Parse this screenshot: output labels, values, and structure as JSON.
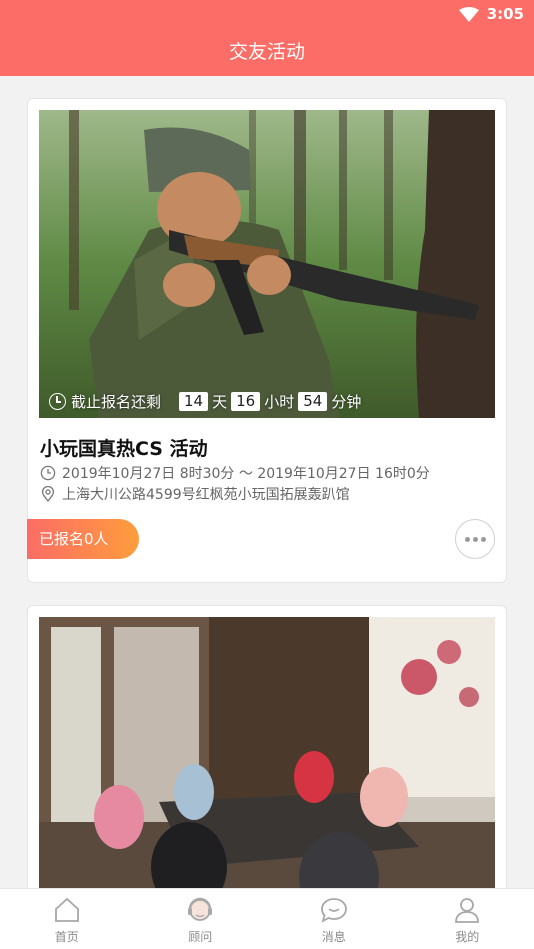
{
  "status": {
    "time": "3:05"
  },
  "header": {
    "title": "交友活动"
  },
  "card1": {
    "countdown": {
      "label": "截止报名还剩",
      "days": "14",
      "days_unit": "天",
      "hours": "16",
      "hours_unit": "小时",
      "minutes": "54",
      "minutes_unit": "分钟"
    },
    "title": "小玩国真热CS 活动",
    "time": "2019年10月27日 8时30分 ～ 2019年10月27日 16时0分",
    "location": "上海大川公路4599号红枫苑小玩国拓展轰趴馆",
    "signup_label": "已报名0人"
  },
  "tabs": [
    {
      "label": "首页",
      "icon": "home-icon"
    },
    {
      "label": "顾问",
      "icon": "advisor-icon"
    },
    {
      "label": "消息",
      "icon": "message-icon"
    },
    {
      "label": "我的",
      "icon": "profile-icon"
    }
  ],
  "colors": {
    "accent": "#fb6d66",
    "gradient_end": "#ff9d3c"
  }
}
